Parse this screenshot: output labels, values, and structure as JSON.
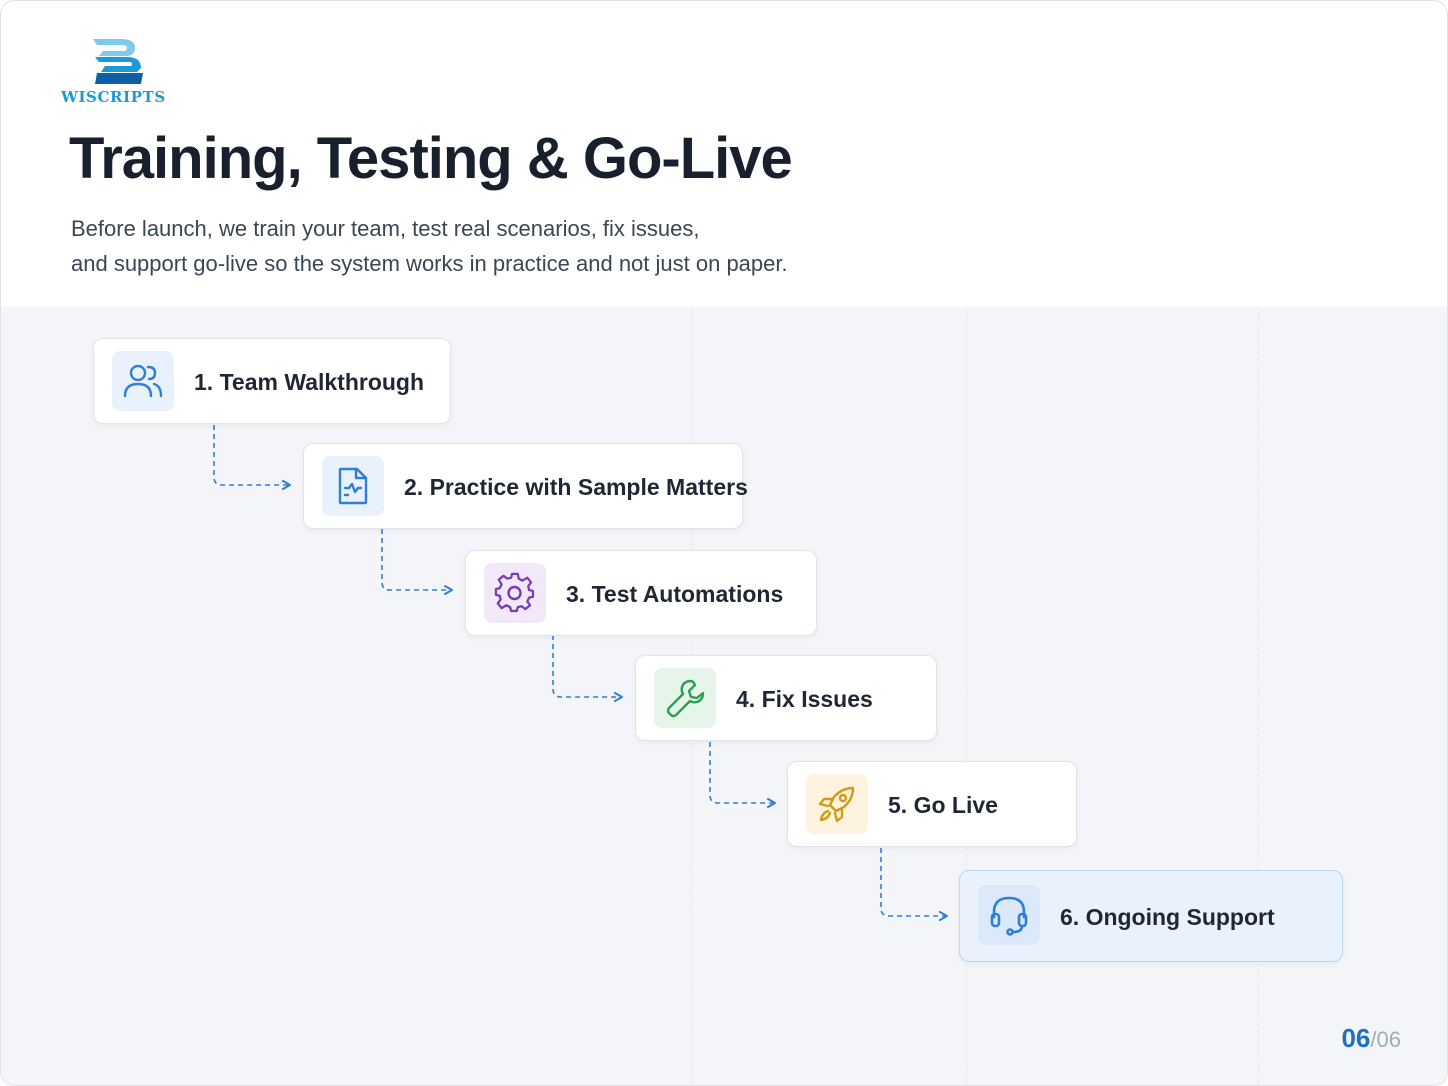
{
  "brand": {
    "name": "WISCRIPTS",
    "logo_icon": "wiscripts-logo-icon",
    "color": "#1b9ad6"
  },
  "title": "Training, Testing & Go-Live",
  "subtitle": {
    "line1": "Before launch, we train your team, test real scenarios, fix issues,",
    "line2": "and support go-live so the system works in practice and not just on paper."
  },
  "steps": [
    {
      "label": "1. Team Walkthrough",
      "icon": "users-icon",
      "icon_color": "#2f7fd6",
      "icon_bg": "#e8f1fc"
    },
    {
      "label": "2. Practice with Sample Matters",
      "icon": "document-icon",
      "icon_color": "#2f7fd6",
      "icon_bg": "#e8f1fc"
    },
    {
      "label": "3. Test Automations",
      "icon": "gear-icon",
      "icon_color": "#7a3bb8",
      "icon_bg": "#f1e9fa"
    },
    {
      "label": "4. Fix Issues",
      "icon": "wrench-icon",
      "icon_color": "#2e9e55",
      "icon_bg": "#e6f5ea"
    },
    {
      "label": "5. Go Live",
      "icon": "rocket-icon",
      "icon_color": "#d39a16",
      "icon_bg": "#fdf3de"
    },
    {
      "label": "6. Ongoing Support",
      "icon": "headset-icon",
      "icon_color": "#2f7fd6",
      "icon_bg": "#dbe9fa",
      "highlighted": true
    }
  ],
  "connector_color": "#2f7fd6",
  "page": {
    "current": "06",
    "separator": "/",
    "total": "06"
  }
}
